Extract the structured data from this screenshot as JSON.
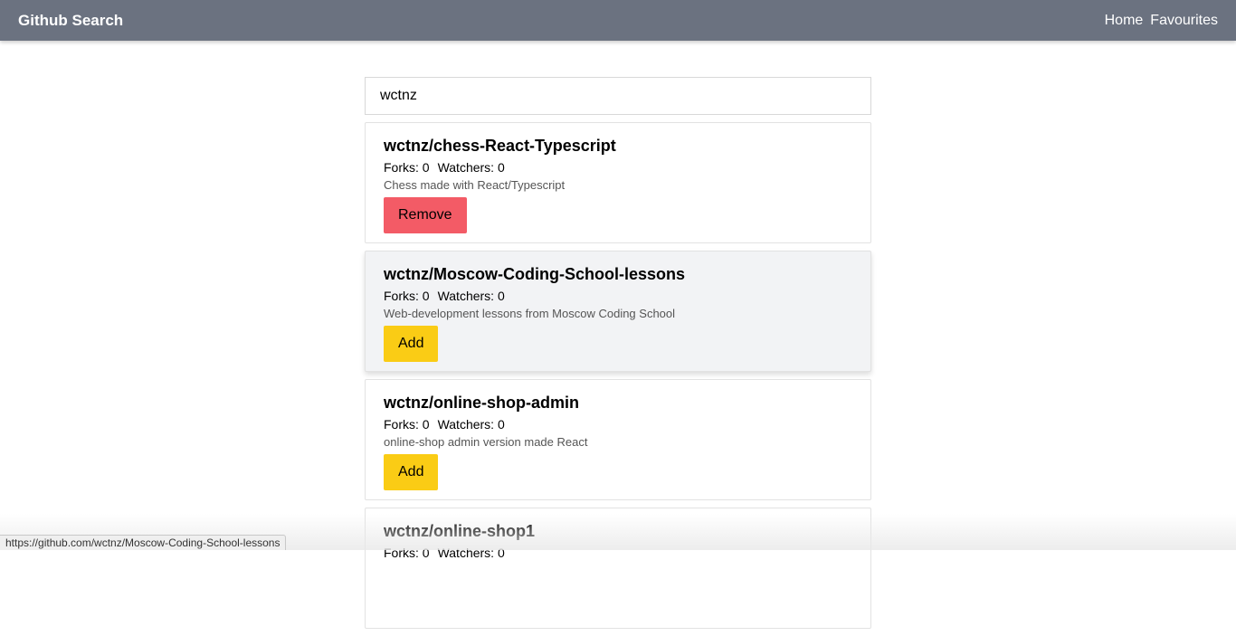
{
  "header": {
    "brand": "Github Search",
    "nav": [
      {
        "label": "Home"
      },
      {
        "label": "Favourites"
      }
    ]
  },
  "search": {
    "value": "wctnz",
    "placeholder": ""
  },
  "repos": [
    {
      "name": "wctnz/chess-React-Typescript",
      "forks_label": "Forks: 0",
      "watchers_label": "Watchers: 0",
      "description": "Chess made with React/Typescript",
      "button_label": "Remove"
    },
    {
      "name": "wctnz/Moscow-Coding-School-lessons",
      "forks_label": "Forks: 0",
      "watchers_label": "Watchers: 0",
      "description": "Web-development lessons from Moscow Coding School",
      "button_label": "Add"
    },
    {
      "name": "wctnz/online-shop-admin",
      "forks_label": "Forks: 0",
      "watchers_label": "Watchers: 0",
      "description": "online-shop admin version made React",
      "button_label": "Add"
    },
    {
      "name": "wctnz/online-shop1",
      "forks_label": "Forks: 0",
      "watchers_label": "Watchers: 0",
      "description": "",
      "button_label": ""
    }
  ],
  "status_bar": {
    "url": "https://github.com/wctnz/Moscow-Coding-School-lessons"
  },
  "colors": {
    "navbar": "#6b7280",
    "remove_button": "#f35b66",
    "add_button": "#facc15",
    "hover_card": "#f2f3f5"
  }
}
